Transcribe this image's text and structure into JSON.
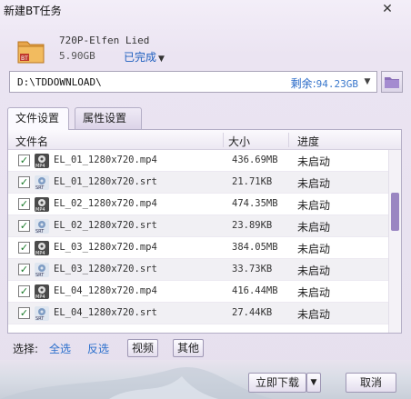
{
  "window": {
    "title": "新建BT任务"
  },
  "task": {
    "name": "720P-Elfen Lied",
    "size": "5.90GB",
    "status": "已完成"
  },
  "path": {
    "value": "D:\\TDDOWNLOAD\\",
    "free_label": "剩余:",
    "free_value": "94.23GB"
  },
  "tabs": [
    {
      "label": "文件设置"
    },
    {
      "label": "属性设置"
    }
  ],
  "columns": {
    "name": "文件名",
    "size": "大小",
    "progress": "进度"
  },
  "files": [
    {
      "name": "EL_01_1280x720.mp4",
      "size": "436.69MB",
      "progress": "未启动",
      "type": "mp4",
      "checked": true
    },
    {
      "name": "EL_01_1280x720.srt",
      "size": "21.71KB",
      "progress": "未启动",
      "type": "srt",
      "checked": true
    },
    {
      "name": "EL_02_1280x720.mp4",
      "size": "474.35MB",
      "progress": "未启动",
      "type": "mp4",
      "checked": true
    },
    {
      "name": "EL_02_1280x720.srt",
      "size": "23.89KB",
      "progress": "未启动",
      "type": "srt",
      "checked": true
    },
    {
      "name": "EL_03_1280x720.mp4",
      "size": "384.05MB",
      "progress": "未启动",
      "type": "mp4",
      "checked": true
    },
    {
      "name": "EL_03_1280x720.srt",
      "size": "33.73KB",
      "progress": "未启动",
      "type": "srt",
      "checked": true
    },
    {
      "name": "EL_04_1280x720.mp4",
      "size": "416.44MB",
      "progress": "未启动",
      "type": "mp4",
      "checked": true
    },
    {
      "name": "EL_04_1280x720.srt",
      "size": "27.44KB",
      "progress": "未启动",
      "type": "srt",
      "checked": true
    }
  ],
  "selection": {
    "label": "选择:",
    "select_all": "全选",
    "invert": "反选",
    "video": "视频",
    "other": "其他"
  },
  "footer": {
    "download": "立即下载",
    "cancel": "取消"
  },
  "colors": {
    "accent": "#2b6fcc",
    "scroll_thumb": "#9a86c2"
  },
  "icons": {
    "close": "close-icon",
    "folder": "folder-icon",
    "mp4": "mp4-file-icon",
    "srt": "srt-file-icon"
  }
}
